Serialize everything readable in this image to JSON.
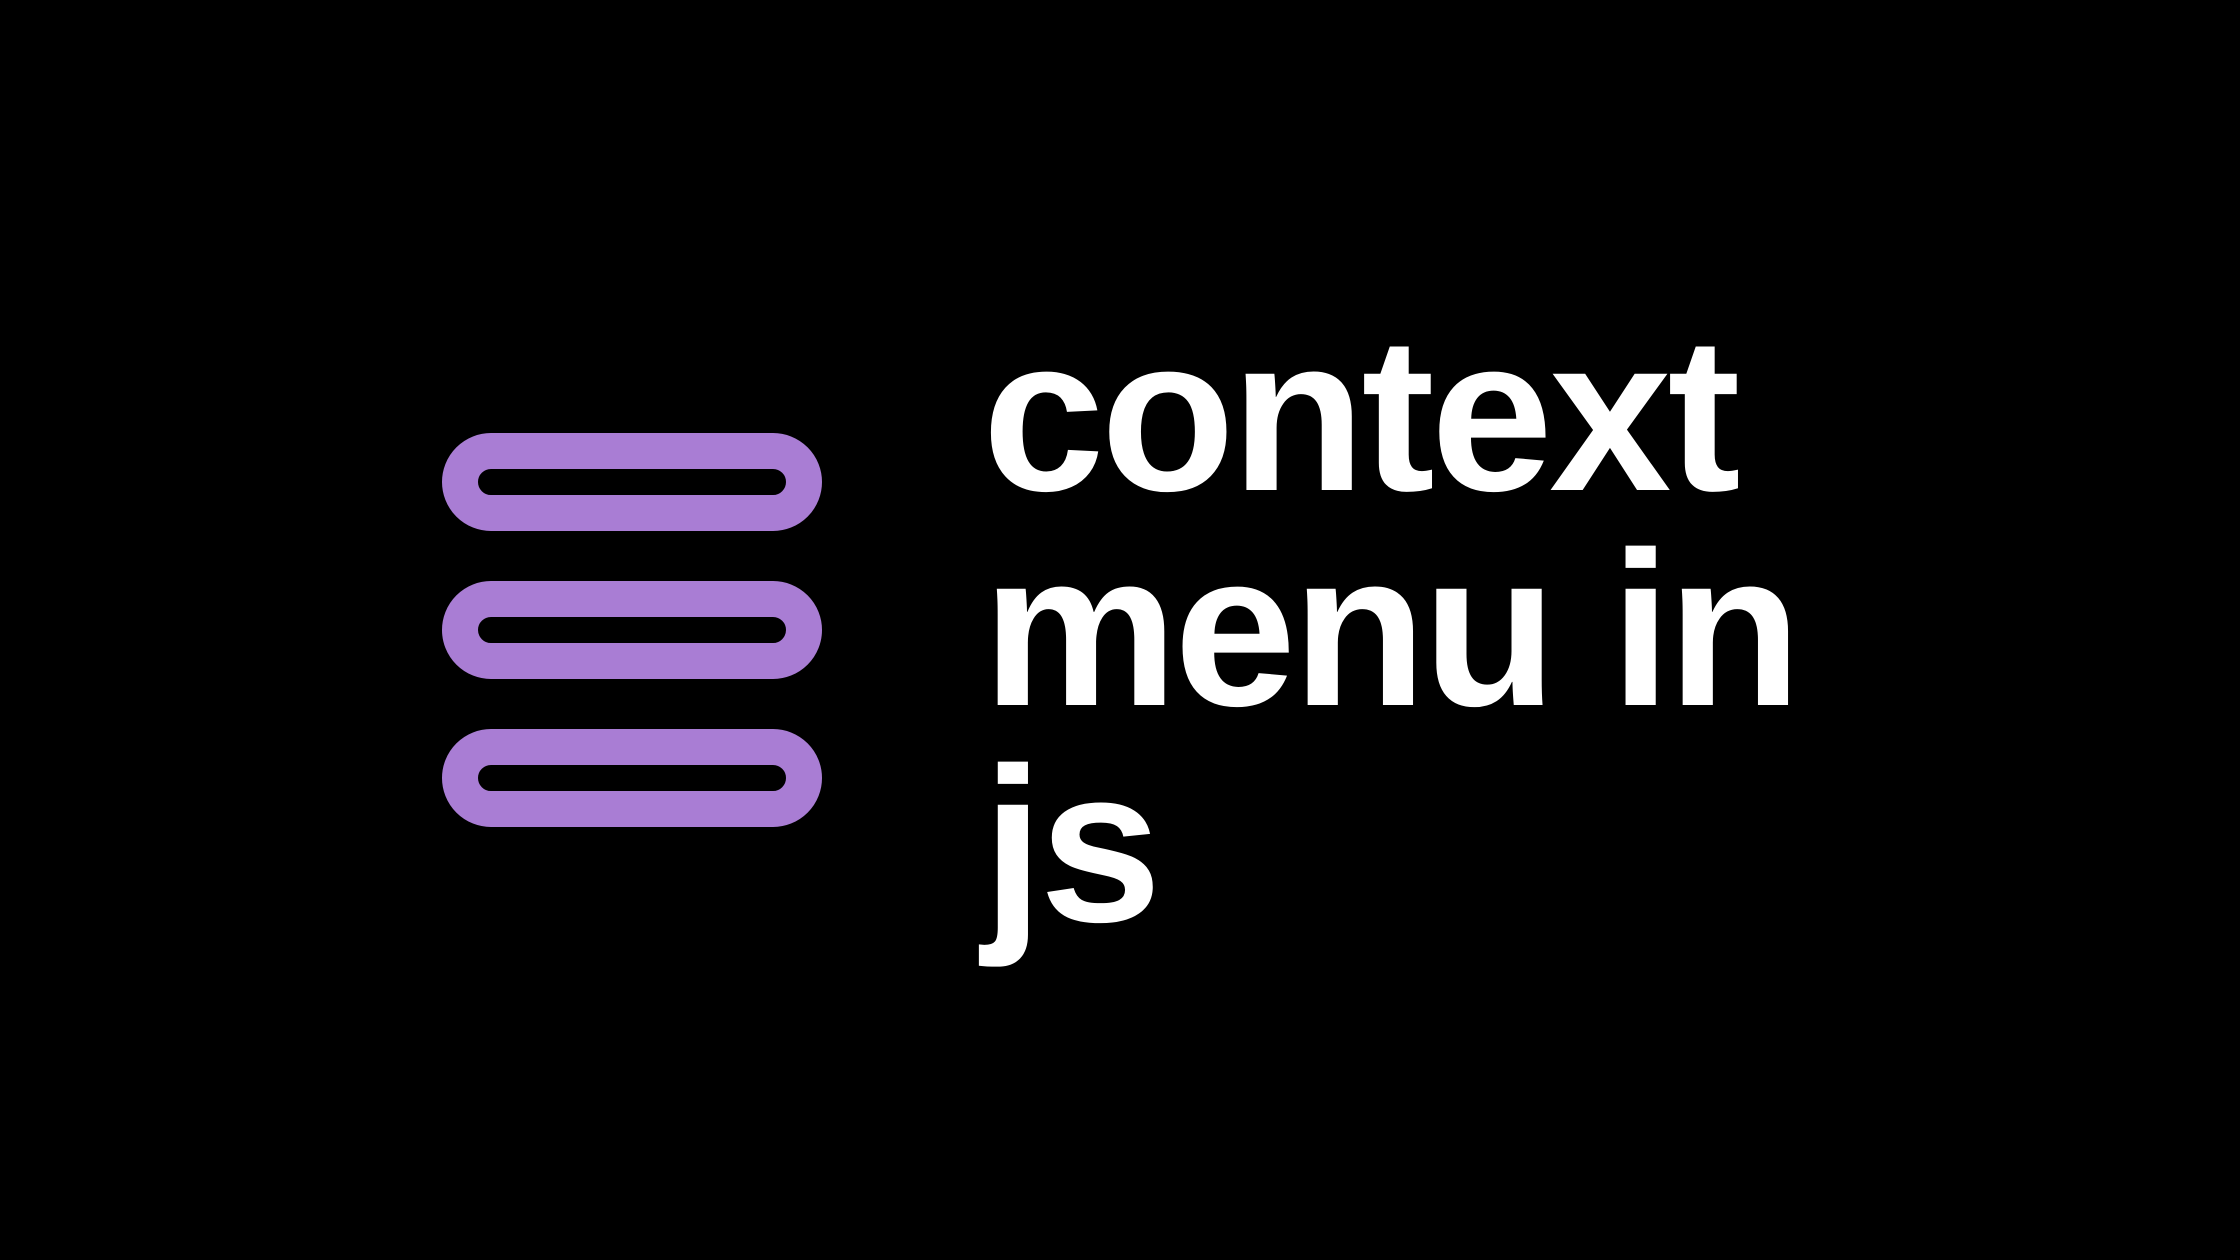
{
  "title": "context\nmenu in\njs",
  "colors": {
    "background": "#000000",
    "text": "#ffffff",
    "icon": "#a97dd4"
  },
  "icon": "menu-three-bars"
}
